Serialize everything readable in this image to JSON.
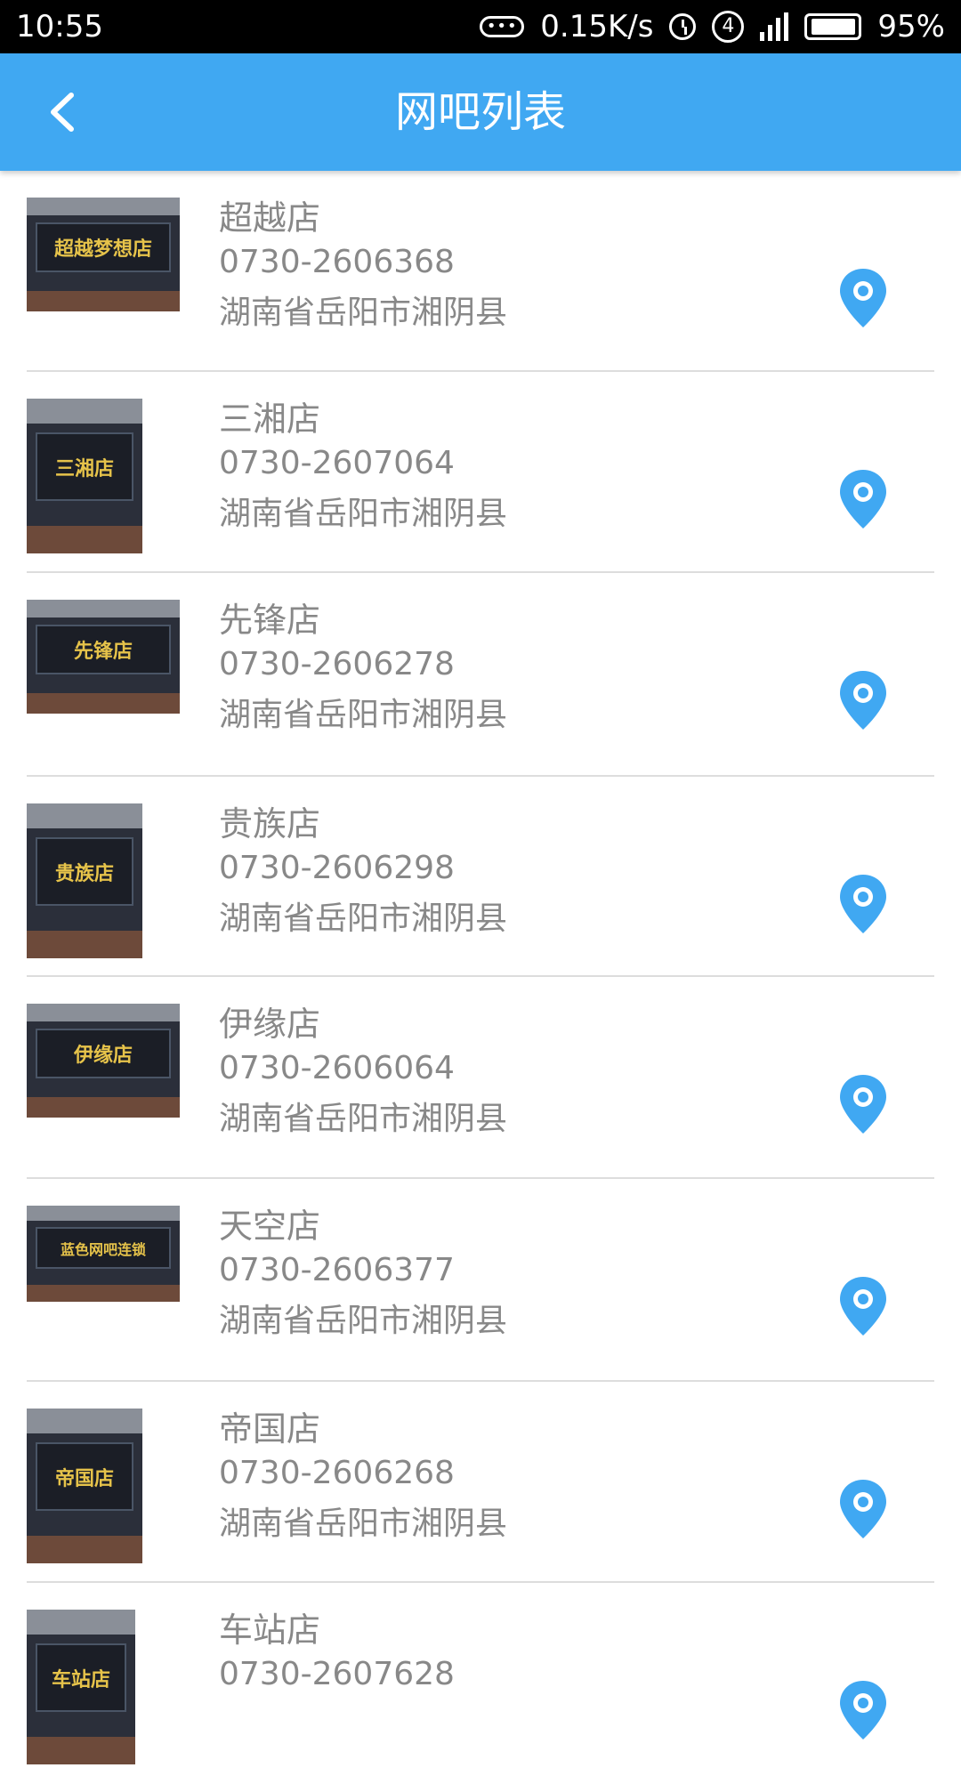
{
  "status_bar": {
    "time": "10:55",
    "net_speed": "0.15K/s",
    "sim_slot": "4",
    "battery": "95%",
    "dots": "•••"
  },
  "header": {
    "title": "网吧列表",
    "accent_color": "#40a8f2"
  },
  "stores": [
    {
      "name": "超越店",
      "phone": "0730-2606368",
      "address": "湖南省岳阳市湘阴县",
      "sign_text": "超越梦想店"
    },
    {
      "name": "三湘店",
      "phone": "0730-2607064",
      "address": "湖南省岳阳市湘阴县",
      "sign_text": "三湘店"
    },
    {
      "name": "先锋店",
      "phone": "0730-2606278",
      "address": "湖南省岳阳市湘阴县",
      "sign_text": "先锋店"
    },
    {
      "name": "贵族店",
      "phone": "0730-2606298",
      "address": "湖南省岳阳市湘阴县",
      "sign_text": "贵族店"
    },
    {
      "name": "伊缘店",
      "phone": "0730-2606064",
      "address": "湖南省岳阳市湘阴县",
      "sign_text": "伊缘店"
    },
    {
      "name": "天空店",
      "phone": "0730-2606377",
      "address": "湖南省岳阳市湘阴县",
      "sign_text": "蓝色网吧连锁"
    },
    {
      "name": "帝国店",
      "phone": "0730-2606268",
      "address": "湖南省岳阳市湘阴县",
      "sign_text": "帝国店"
    },
    {
      "name": "车站店",
      "phone": "0730-2607628",
      "address": "",
      "sign_text": "车站店"
    }
  ]
}
